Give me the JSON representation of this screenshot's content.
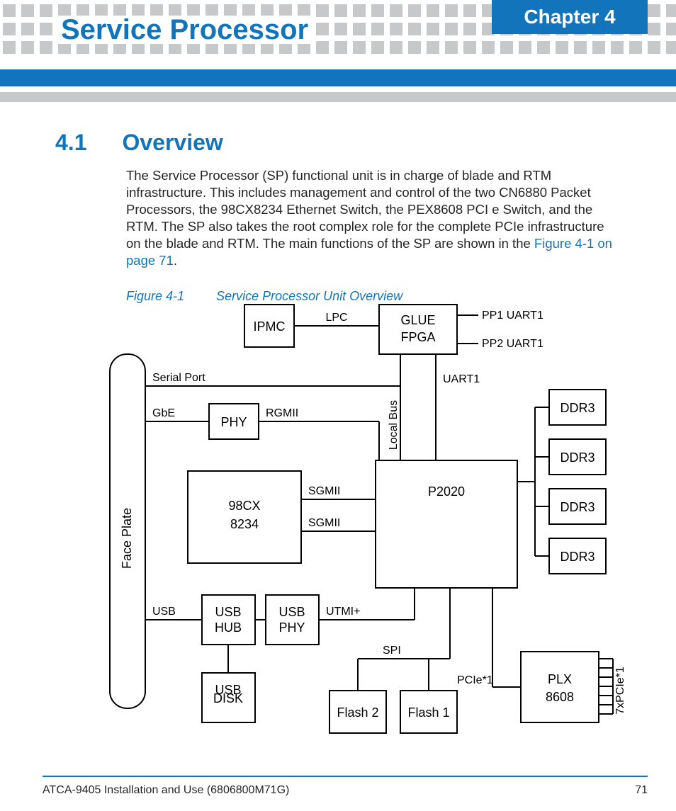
{
  "header": {
    "chapter_label": "Chapter 4",
    "page_title": "Service Processor"
  },
  "section": {
    "number": "4.1",
    "title": "Overview",
    "paragraph": "The Service Processor (SP) functional unit is in charge of blade and RTM infrastructure. This includes management and control of the two CN6880 Packet Processors, the 98CX8234 Ethernet Switch, the PEX8608 PCI e Switch, and the RTM. The SP also takes the root complex role for the complete PCIe infrastructure on the blade and RTM. The main functions of the SP are shown in the ",
    "xref_text": "Figure 4-1 on page 71",
    "paragraph_tail": "."
  },
  "figure": {
    "id": "Figure 4-1",
    "title": "Service Processor Unit Overview",
    "blocks": {
      "face_plate": "Face Plate",
      "ipmc": "IPMC",
      "glue_fpga_l1": "GLUE",
      "glue_fpga_l2": "FPGA",
      "phy": "PHY",
      "cx_l1": "98CX",
      "cx_l2": "8234",
      "p2020": "P2020",
      "ddr3": "DDR3",
      "usb_hub_l1": "USB",
      "usb_hub_l2": "HUB",
      "usb_phy_l1": "USB",
      "usb_phy_l2": "PHY",
      "usb_disk_l1": "USB",
      "usb_disk_l2": "DISK",
      "flash2": "Flash 2",
      "flash1": "Flash 1",
      "plx_l1": "PLX",
      "plx_l2": "8608"
    },
    "labels": {
      "lpc": "LPC",
      "pp1": "PP1 UART1",
      "pp2": "PP2 UART1",
      "serial": "Serial Port",
      "gbe": "GbE",
      "rgmii": "RGMII",
      "uart1": "UART1",
      "local_bus": "Local Bus",
      "sgmii": "SGMII",
      "utmi": "UTMI+",
      "usb": "USB",
      "spi": "SPI",
      "pcie_x1": "PCIe*1",
      "pcie_7x": "7xPCIe*1"
    }
  },
  "footer": {
    "doc_id": "ATCA-9405 Installation and Use (6806800M71G)",
    "page_number": "71"
  }
}
